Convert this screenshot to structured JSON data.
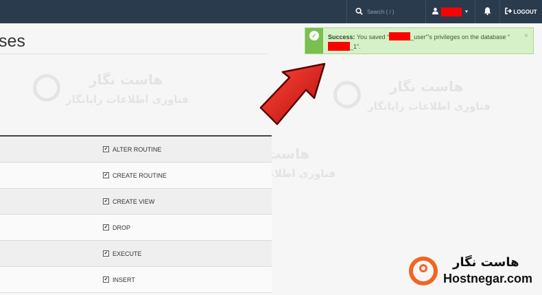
{
  "topbar": {
    "search_placeholder": "Search ( / )",
    "logout_label": "LOGOUT"
  },
  "page": {
    "title_fragment": "ses"
  },
  "alert": {
    "label": "Success:",
    "text_1": "You saved “",
    "text_2": "_user”’s privileges on the database “",
    "text_3": "_1”.",
    "close": "×"
  },
  "privileges": [
    {
      "label": "ALTER ROUTINE",
      "checked": true
    },
    {
      "label": "CREATE ROUTINE",
      "checked": true
    },
    {
      "label": "CREATE VIEW",
      "checked": true
    },
    {
      "label": "DROP",
      "checked": true
    },
    {
      "label": "EXECUTE",
      "checked": true
    },
    {
      "label": "INSERT",
      "checked": true
    }
  ],
  "branding": {
    "logo_fa": "هاست نگار",
    "logo_en": "Hostnegar.com",
    "watermark_line1": "هاست نگار",
    "watermark_line2": "فناوری اطلاعات رایانگار"
  },
  "colors": {
    "topbar": "#2a3b4d",
    "success_bg": "#d6f1c8",
    "success_accent": "#79c04f",
    "arrow": "#d81f1f",
    "brand_orange": "#f26522"
  },
  "icons": {
    "search": "search-icon",
    "user": "user-icon",
    "bell": "bell-icon",
    "logout": "logout-icon",
    "success": "check-circle-icon"
  }
}
